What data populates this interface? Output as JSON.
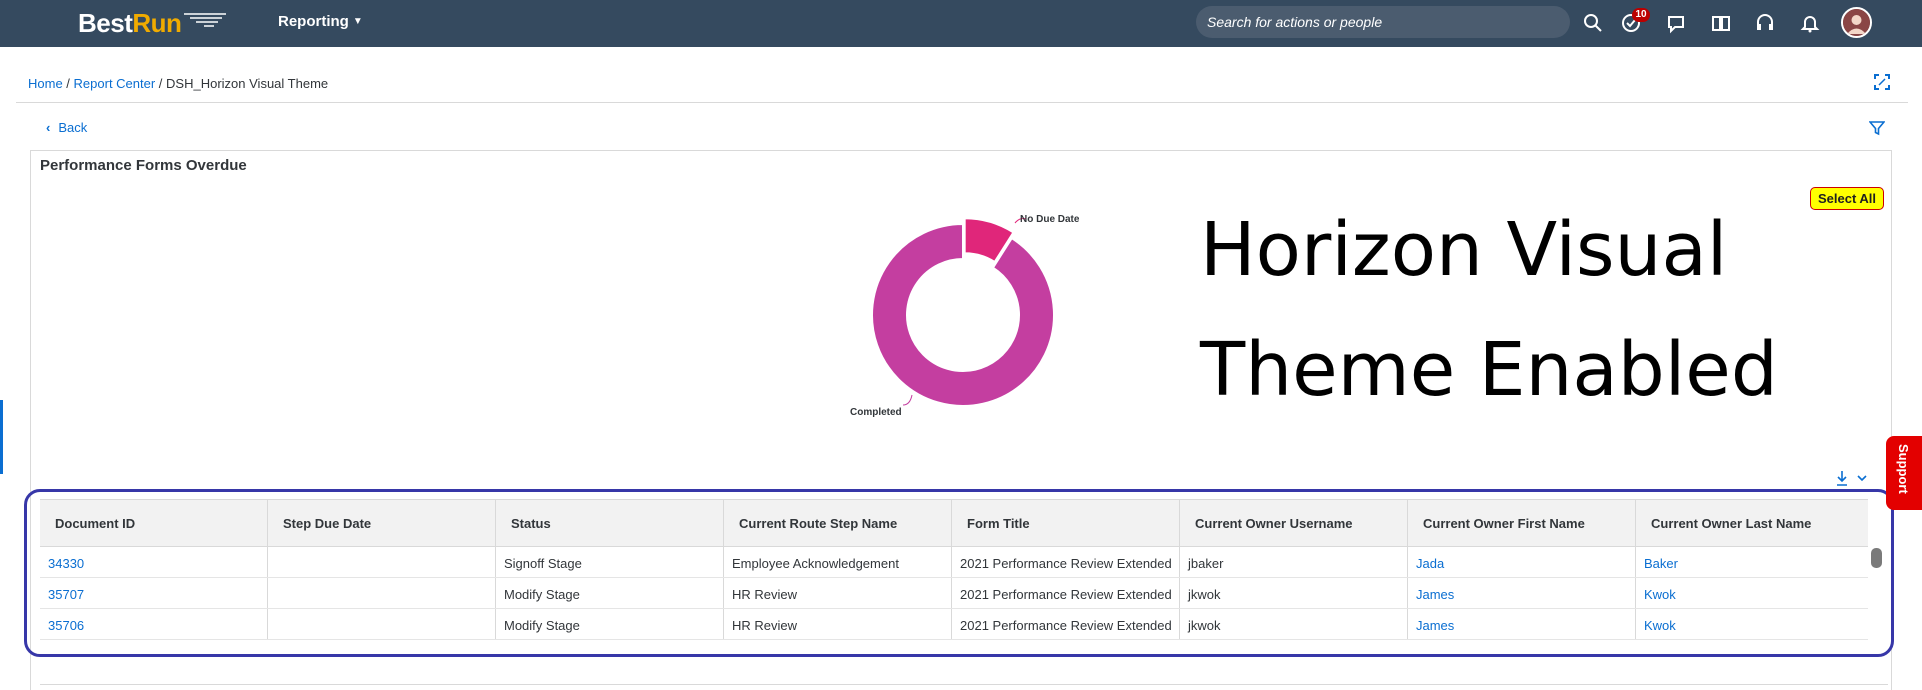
{
  "shell": {
    "logo_best": "Best",
    "logo_run": "Run",
    "menu_label": "Reporting",
    "search_placeholder": "Search for actions or people",
    "notification_count": "10",
    "icons": [
      "search-icon",
      "approvals-icon",
      "chat-icon",
      "learning-icon",
      "support-headset-icon",
      "bell-icon"
    ]
  },
  "breadcrumb": {
    "home": "Home",
    "sep1": " / ",
    "report_center": "Report Center",
    "sep2": " / ",
    "current": "DSH_Horizon Visual Theme"
  },
  "back_label": "Back",
  "panel": {
    "title": "Performance Forms Overdue",
    "select_all": "Select All"
  },
  "chart_data": {
    "type": "pie",
    "categories": [
      "No Due Date",
      "Completed"
    ],
    "values": [
      9,
      91
    ],
    "colors": [
      "#e0267a",
      "#c43ea0"
    ],
    "title": ""
  },
  "banner": {
    "line1": "Horizon Visual",
    "line2": "Theme Enabled"
  },
  "support_label": "Support",
  "table": {
    "columns": [
      "Document ID",
      "Step Due Date",
      "Status",
      "Current Route Step Name",
      "Form Title",
      "Current Owner Username",
      "Current Owner First Name",
      "Current Owner Last Name"
    ],
    "rows": [
      [
        "34330",
        "",
        "Signoff Stage",
        "Employee Acknowledgement",
        "2021 Performance Review Extended",
        "jbaker",
        "Jada",
        "Baker"
      ],
      [
        "35707",
        "",
        "Modify Stage",
        "HR Review",
        "2021 Performance Review Extended",
        "jkwok",
        "James",
        "Kwok"
      ],
      [
        "35706",
        "",
        "Modify Stage",
        "HR Review",
        "2021 Performance Review Extended",
        "jkwok",
        "James",
        "Kwok"
      ]
    ]
  },
  "colors": {
    "shell_bg": "#354a5f",
    "link": "#0a6ed1",
    "highlight_border": "#3737a8",
    "support_bg": "#e30000"
  }
}
